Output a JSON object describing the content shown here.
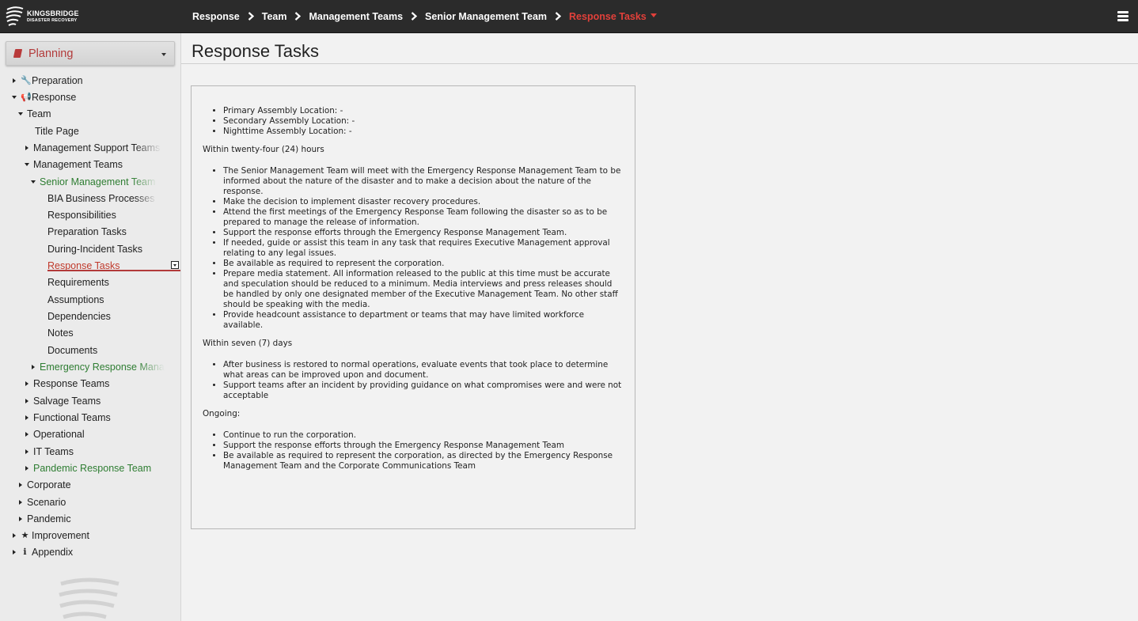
{
  "app": {
    "brand_name": "KINGSBRIDGE",
    "brand_sub": "DISASTER RECOVERY"
  },
  "breadcrumb": [
    "Response",
    "Team",
    "Management Teams",
    "Senior Management Team",
    "Response Tasks"
  ],
  "sidebar": {
    "plan_label": "Planning",
    "items": [
      {
        "label": "Preparation"
      },
      {
        "label": "Response"
      },
      {
        "label": "Team"
      },
      {
        "label": "Title Page"
      },
      {
        "label": "Management Support Teams"
      },
      {
        "label": "Management Teams"
      },
      {
        "label": "Senior Management Team"
      },
      {
        "label": "BIA Business Processes"
      },
      {
        "label": "Responsibilities"
      },
      {
        "label": "Preparation Tasks"
      },
      {
        "label": "During-Incident Tasks"
      },
      {
        "label": "Response Tasks"
      },
      {
        "label": "Requirements"
      },
      {
        "label": "Assumptions"
      },
      {
        "label": "Dependencies"
      },
      {
        "label": "Notes"
      },
      {
        "label": "Documents"
      },
      {
        "label": "Emergency Response Mana"
      },
      {
        "label": "Response Teams"
      },
      {
        "label": "Salvage Teams"
      },
      {
        "label": "Functional Teams"
      },
      {
        "label": "Operational"
      },
      {
        "label": "IT Teams"
      },
      {
        "label": "Pandemic Response Team"
      },
      {
        "label": "Corporate"
      },
      {
        "label": "Scenario"
      },
      {
        "label": "Pandemic"
      },
      {
        "label": "Improvement"
      },
      {
        "label": "Appendix"
      }
    ]
  },
  "main": {
    "title": "Response Tasks",
    "content": {
      "locations": [
        "Primary Assembly Location: -",
        "Secondary Assembly Location: -",
        "Nighttime Assembly Location: -"
      ],
      "section1_heading": "Within twenty-four (24) hours",
      "section1_items": [
        "The Senior Management Team will meet with the Emergency Response Management Team to be informed about the nature of the disaster and to make a decision about the nature of the response.",
        "Make the decision to implement disaster recovery procedures.",
        "Attend the first meetings of the Emergency Response Team following the disaster so as to be prepared to manage the release of information.",
        "Support the response efforts through the Emergency Response Management Team.",
        "If needed, guide or assist this team in any task that requires Executive Management approval relating to any legal issues.",
        "Be available as required to represent the corporation.",
        "Prepare media statement. All information released to the public at this time must be accurate and speculation should be reduced to a minimum. Media interviews and press releases should be handled by only one designated member of the Executive Management Team. No other staff should be speaking with the media.",
        "Provide headcount assistance to department or teams that may have limited workforce available."
      ],
      "section2_heading": "Within seven (7) days",
      "section2_items": [
        "After business is restored to normal operations, evaluate events that took place to determine what areas can be improved upon and document.",
        "Support teams after an incident by providing guidance on what compromises were and were not acceptable"
      ],
      "section3_heading": "Ongoing:",
      "section3_items": [
        "Continue to run the corporation.",
        "Support the response efforts through the Emergency Response Management Team",
        "Be available as required to represent the corporation, as directed by the Emergency Response Management Team and the Corporate Communications Team"
      ]
    }
  },
  "colors": {
    "topbar": "#2b2b2b",
    "active_breadcrumb": "#e2403a",
    "green_item": "#2e7d32",
    "selected_item": "#c0392b"
  }
}
